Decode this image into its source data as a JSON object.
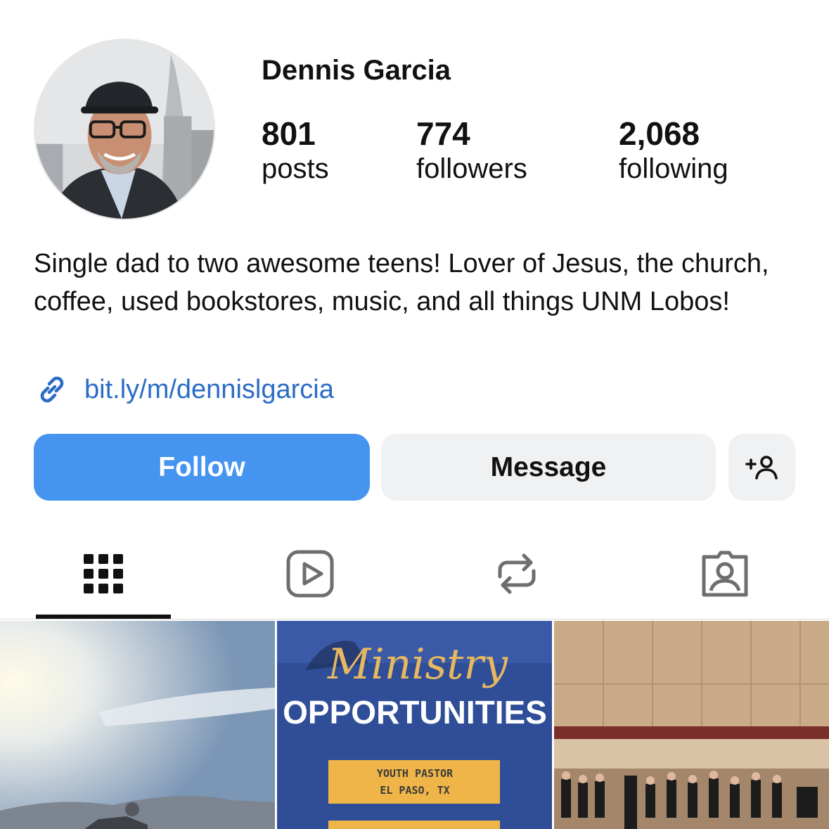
{
  "profile": {
    "username": "Dennis Garcia",
    "avatar_alt": "profile-photo"
  },
  "stats": {
    "posts": {
      "value": "801",
      "label": "posts"
    },
    "followers": {
      "value": "774",
      "label": "followers"
    },
    "following": {
      "value": "2,068",
      "label": "following"
    }
  },
  "bio": {
    "text": "Single dad to two awesome teens! Lover of Jesus, the church, coffee, used bookstores, music, and all things UNM Lobos!",
    "link": "bit.ly/m/dennislgarcia",
    "link_icon": "link-icon"
  },
  "actions": {
    "follow": "Follow",
    "message": "Message",
    "add_user_icon": "add-person-icon"
  },
  "tabs": [
    {
      "name": "grid",
      "icon": "grid-icon",
      "active": true
    },
    {
      "name": "reels",
      "icon": "reels-icon",
      "active": false
    },
    {
      "name": "reposts",
      "icon": "repost-icon",
      "active": false
    },
    {
      "name": "tagged",
      "icon": "tagged-icon",
      "active": false
    }
  ],
  "posts": [
    {
      "kind": "photo",
      "description": "sky-landscape"
    },
    {
      "kind": "graphic",
      "script_text": "Ministry",
      "headline": "OPPORTUNITIES",
      "box_line1": "YOUTH PASTOR",
      "box_line2": "EL PASO, TX"
    },
    {
      "kind": "photo",
      "description": "choir-performance"
    }
  ],
  "colors": {
    "accent": "#4494f0",
    "link": "#2a6cc8",
    "secondary_button": "#f0f1f3",
    "text": "#111111"
  }
}
